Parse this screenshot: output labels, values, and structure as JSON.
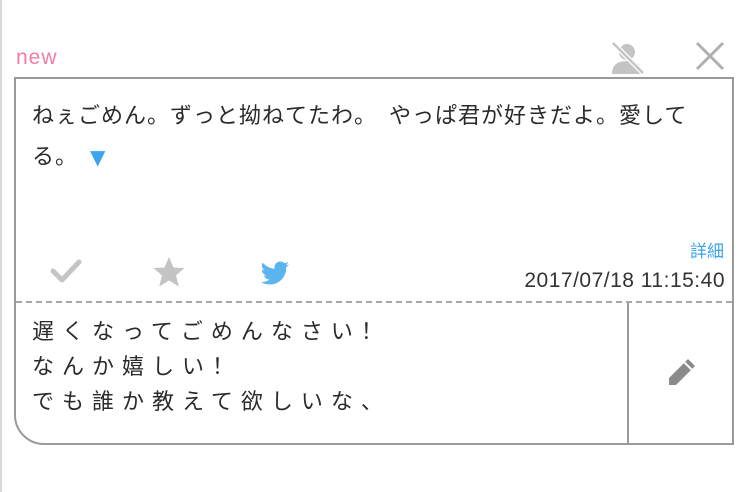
{
  "header": {
    "badge": "new",
    "icons": {
      "mute": "user-mute-icon",
      "close": "close-icon"
    }
  },
  "message": {
    "text": "ねぇごめん。ずっと拗ねてたわ。　やっぱ君が好きだよ。愛してる。",
    "more_indicator": "▼",
    "detail_label": "詳細",
    "timestamp": "2017/07/18 11:15:40",
    "actions": [
      "check-icon",
      "star-icon",
      "twitter-icon"
    ]
  },
  "reply": {
    "lines": [
      "遅くなってごめんなさい！",
      "なんか嬉しい！",
      "でも誰か教えて欲しいな、"
    ],
    "edit_icon": "pencil-icon"
  },
  "colors": {
    "accent_pink": "#f07ea6",
    "accent_blue": "#3aa5ee",
    "border": "#9a9a9a",
    "icon_gray": "#c4c4c4"
  }
}
